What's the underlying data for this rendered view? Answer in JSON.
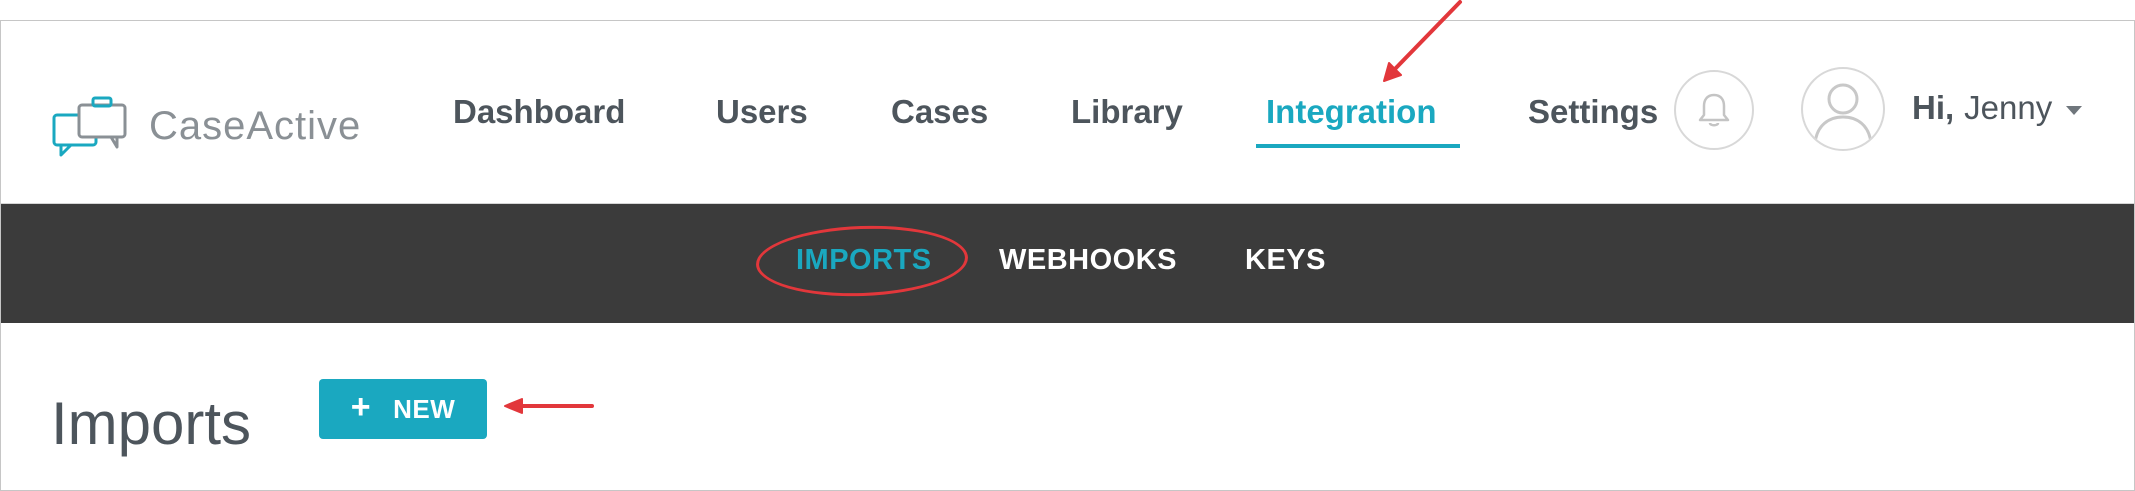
{
  "app": {
    "logo_text": "CaseActive",
    "brand_color": "#1aa8c0",
    "annotation_color": "#e2373b"
  },
  "nav": {
    "items": [
      {
        "label": "Dashboard"
      },
      {
        "label": "Users"
      },
      {
        "label": "Cases"
      },
      {
        "label": "Library"
      },
      {
        "label": "Integration",
        "active": true
      },
      {
        "label": "Settings"
      }
    ]
  },
  "header": {
    "notification_icon": "bell-icon",
    "avatar_icon": "user-avatar-icon",
    "greeting_prefix": "Hi,",
    "user_name": "Jenny",
    "dropdown_icon": "caret-down-icon"
  },
  "subnav": {
    "items": [
      {
        "label": "IMPORTS",
        "active": true
      },
      {
        "label": "WEBHOOKS"
      },
      {
        "label": "KEYS"
      }
    ]
  },
  "main": {
    "title": "Imports",
    "new_button_icon": "plus-icon",
    "new_button_plus": "+",
    "new_button_label": "NEW"
  }
}
